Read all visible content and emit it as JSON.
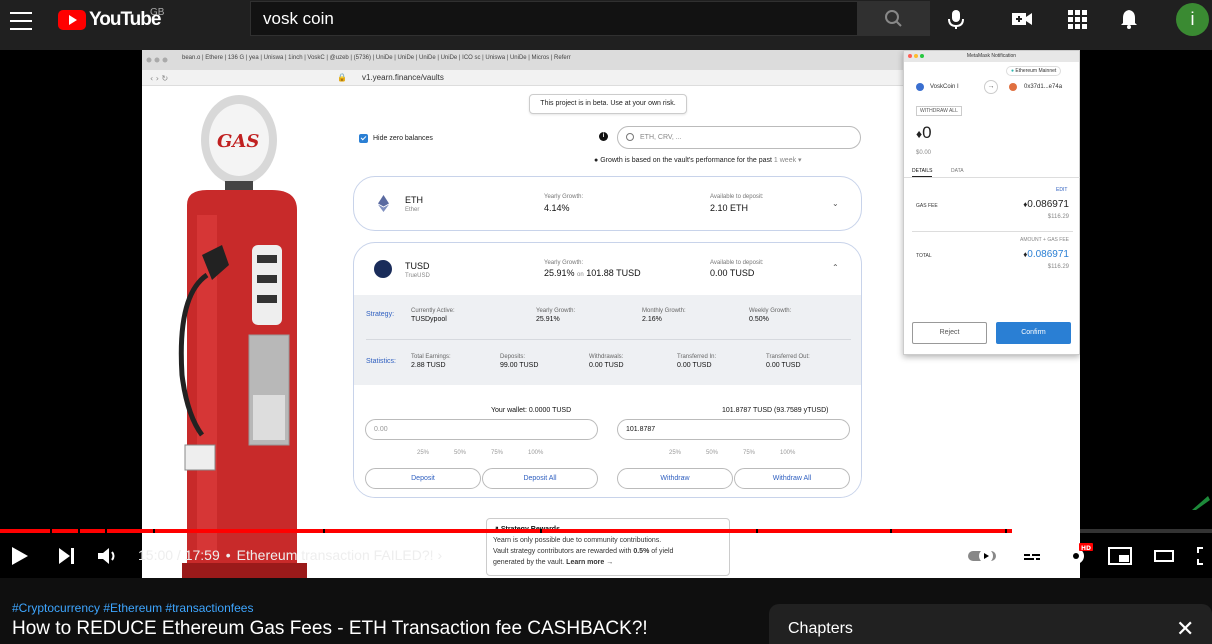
{
  "header": {
    "logo_text": "YouTube",
    "country_code": "GB",
    "search_value": "vosk coin",
    "avatar_initial": "i"
  },
  "video": {
    "browser": {
      "tabs_text": "bean.o | Ethere | 136 G | yea | Uniswa | 1inch | VoskC | @uzeb | (5736) | UniDe | UniDe | UniDe | UniDe | ICO sc | Uniswa | UniDe | Micros | Referr",
      "url": "v1.yearn.finance/vaults"
    },
    "beta_notice": "This project is in beta. Use at your own risk.",
    "hide_zero_label": "Hide zero balances",
    "search_placeholder": "ETH, CRV, ...",
    "growth_note": "Growth is based on the vault's performance for the past",
    "growth_period": "1 week",
    "eth": {
      "name": "ETH",
      "sub": "Ether",
      "growth_label": "Yearly Growth:",
      "growth_value": "4.14%",
      "avail_label": "Available to deposit:",
      "avail_value": "2.10 ETH"
    },
    "tusd": {
      "name": "TUSD",
      "sub": "TrueUSD",
      "growth_label": "Yearly Growth:",
      "growth_value": "25.91%",
      "growth_on": "on",
      "growth_base": "101.88 TUSD",
      "avail_label": "Available to deposit:",
      "avail_value": "0.00 TUSD",
      "strategy_label": "Strategy:",
      "current_label": "Currently Active:",
      "current_value": "TUSDypool",
      "yearly_label": "Yearly Growth:",
      "yearly_value": "25.91%",
      "monthly_label": "Monthly Growth:",
      "monthly_value": "2.16%",
      "weekly_label": "Weekly Growth:",
      "weekly_value": "0.50%",
      "statistics_label": "Statistics:",
      "earnings_label": "Total Earnings:",
      "earnings_value": "2.88 TUSD",
      "deposits_label": "Deposits:",
      "deposits_value": "99.00 TUSD",
      "withdrawals_label": "Withdrawals:",
      "withdrawals_value": "0.00 TUSD",
      "tin_label": "Transferred In:",
      "tin_value": "0.00 TUSD",
      "tout_label": "Transferred Out:",
      "tout_value": "0.00 TUSD",
      "wallet": "Your wallet: 0.0000 TUSD",
      "vault_balance": "101.8787 TUSD (93.7589 yTUSD)",
      "deposit_input": "0.00",
      "withdraw_input": "101.8787",
      "pcts": [
        "25%",
        "50%",
        "75%",
        "100%"
      ],
      "deposit_btn": "Deposit",
      "deposit_all_btn": "Deposit All",
      "withdraw_btn": "Withdraw",
      "withdraw_all_btn": "Withdraw All"
    },
    "rewards": {
      "title": "Strategy Rewards",
      "body1": "Yearn is only possible due to community contributions.",
      "body2": "Vault strategy contributors are rewarded with",
      "body2_pct": "0.5%",
      "body2_end": "of yield",
      "body3": "generated by the vault.",
      "learn_more": "Learn more →"
    },
    "metamask": {
      "title": "MetaMask Notification",
      "network": "Ethereum Mainnet",
      "from": "VoskCoin I",
      "to": "0x37d1...e74a",
      "action": "WITHDRAW ALL",
      "amount": "0",
      "amount_usd": "$0.00",
      "tab_details": "DETAILS",
      "tab_data": "DATA",
      "edit": "EDIT",
      "gas_label": "GAS FEE",
      "gas_value": "0.086971",
      "gas_usd": "$116.29",
      "total_hint": "AMOUNT + GAS FEE",
      "total_label": "TOTAL",
      "total_value": "0.086971",
      "total_usd": "$116.29",
      "reject": "Reject",
      "confirm": "Confirm"
    }
  },
  "player": {
    "current_time": "15:00",
    "duration": "17:59",
    "chapter_title": "Ethereum transaction FAILED?!",
    "progress_played_fraction": 0.835,
    "progress_buffered_fraction": 0.88
  },
  "below": {
    "tags": "#Cryptocurrency #Ethereum #transactionfees",
    "title": "How to REDUCE Ethereum Gas Fees - ETH Transaction fee CASHBACK?!",
    "chapters_label": "Chapters"
  },
  "colors": {
    "yt_red": "#ff0000",
    "link_blue": "#3ea6ff",
    "mm_confirm": "#2a7fd4"
  }
}
